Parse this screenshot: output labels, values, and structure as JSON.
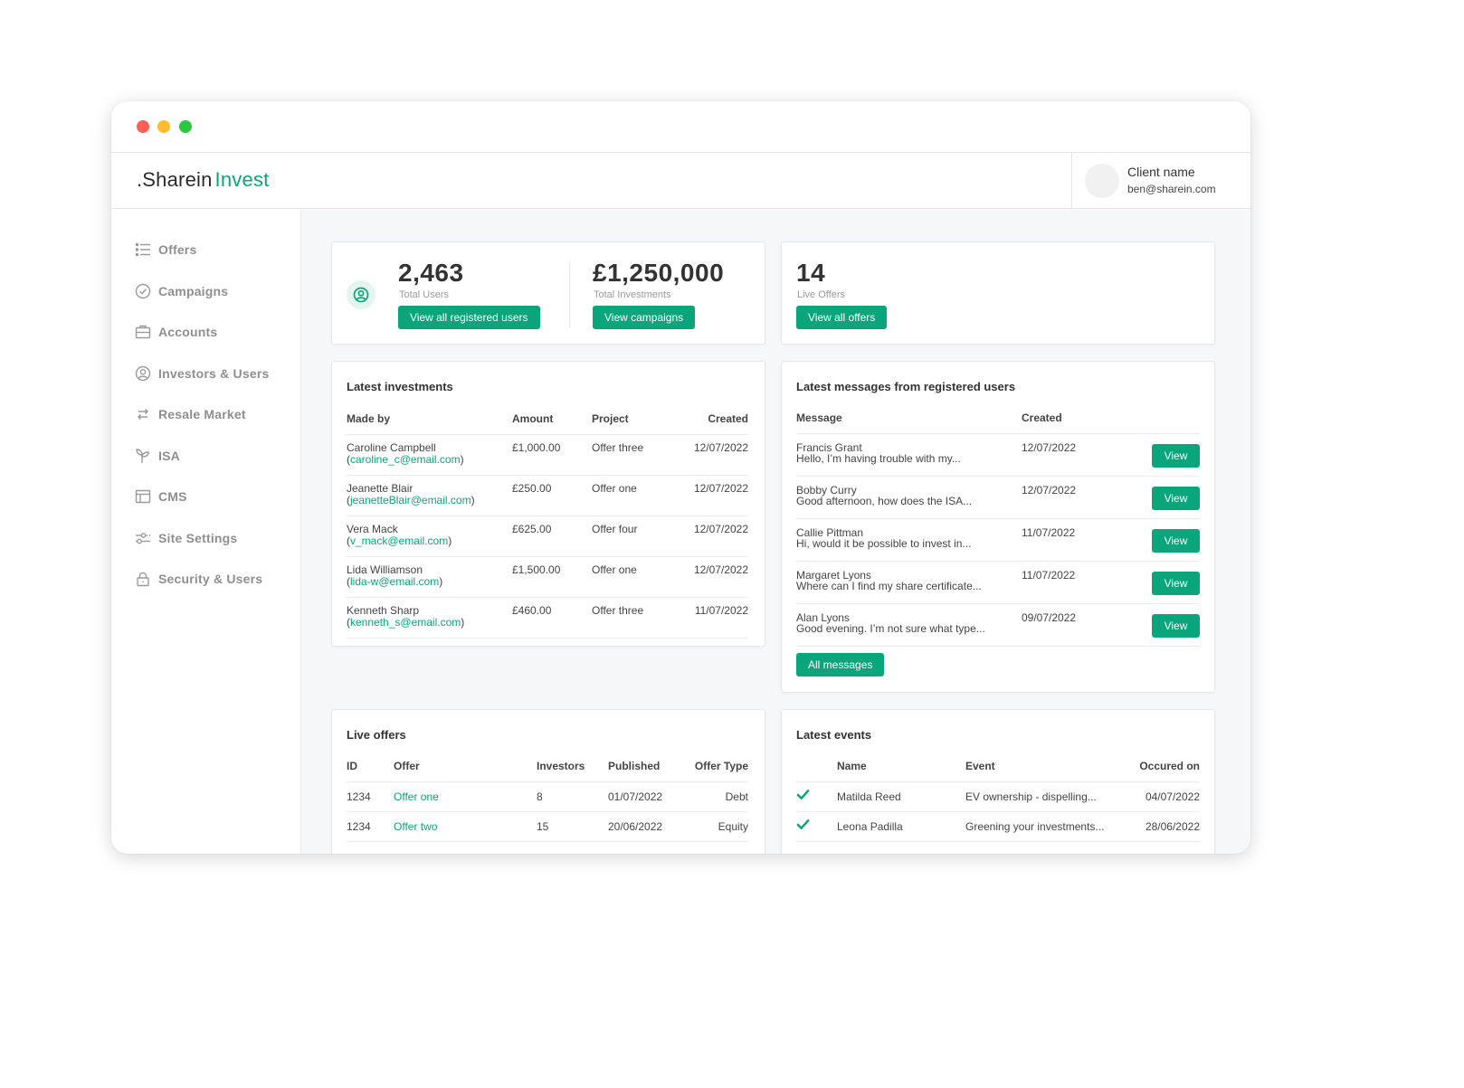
{
  "window": {
    "controls": [
      "close",
      "minimize",
      "maximize"
    ]
  },
  "header": {
    "logo_part1": ".Sharein",
    "logo_part2": "Invest",
    "client_name": "Client name",
    "client_email": "ben@sharein.com"
  },
  "sidebar": {
    "items": [
      {
        "label": "Offers",
        "icon": "list-icon"
      },
      {
        "label": "Campaigns",
        "icon": "check-circle-icon"
      },
      {
        "label": "Accounts",
        "icon": "briefcase-icon"
      },
      {
        "label": "Investors & Users",
        "icon": "user-circle-icon"
      },
      {
        "label": "Resale Market",
        "icon": "arrows-swap-icon"
      },
      {
        "label": "ISA",
        "icon": "sprout-icon"
      },
      {
        "label": "CMS",
        "icon": "layout-icon"
      },
      {
        "label": "Site Settings",
        "icon": "sliders-icon"
      },
      {
        "label": "Security & Users",
        "icon": "lock-icon"
      }
    ]
  },
  "stats": {
    "users": {
      "value": "2,463",
      "label": "Total Users",
      "button": "View all registered users"
    },
    "investments": {
      "value": "£1,250,000",
      "label": "Total Investments",
      "button": "View campaigns"
    },
    "offers": {
      "value": "14",
      "label": "Live Offers",
      "button": "View all offers"
    }
  },
  "latest_investments": {
    "title": "Latest investments",
    "columns": [
      "Made by",
      "Amount",
      "Project",
      "Created"
    ],
    "rows": [
      {
        "name": "Caroline Campbell",
        "email": "caroline_c@email.com",
        "amount": "£1,000.00",
        "project": "Offer three",
        "created": "12/07/2022"
      },
      {
        "name": "Jeanette Blair",
        "email": "jeanetteBlair@email.com",
        "amount": "£250.00",
        "project": "Offer one",
        "created": "12/07/2022"
      },
      {
        "name": "Vera Mack",
        "email": "v_mack@email.com",
        "amount": "£625.00",
        "project": "Offer four",
        "created": "12/07/2022"
      },
      {
        "name": "Lida Williamson",
        "email": "lida-w@email.com",
        "amount": "£1,500.00",
        "project": "Offer one",
        "created": "12/07/2022"
      },
      {
        "name": "Kenneth Sharp",
        "email": "kenneth_s@email.com",
        "amount": "£460.00",
        "project": "Offer three",
        "created": "11/07/2022"
      }
    ]
  },
  "latest_messages": {
    "title": "Latest messages from registered users",
    "columns": [
      "Message",
      "Created",
      ""
    ],
    "view_label": "View",
    "all_button": "All messages",
    "rows": [
      {
        "name": "Francis Grant",
        "preview": "Hello, I’m having trouble with my...",
        "created": "12/07/2022"
      },
      {
        "name": "Bobby Curry",
        "preview": "Good afternoon, how does the ISA...",
        "created": "12/07/2022"
      },
      {
        "name": "Callie Pittman",
        "preview": "Hi, would it be possible to invest in...",
        "created": "11/07/2022"
      },
      {
        "name": "Margaret Lyons",
        "preview": "Where can I find my share certificate...",
        "created": "11/07/2022"
      },
      {
        "name": "Alan Lyons",
        "preview": "Good evening. I’m not sure what type...",
        "created": "09/07/2022"
      }
    ]
  },
  "live_offers": {
    "title": "Live offers",
    "columns": [
      "ID",
      "Offer",
      "Investors",
      "Published",
      "Offer Type"
    ],
    "rows": [
      {
        "id": "1234",
        "offer": "Offer one",
        "investors": "8",
        "published": "01/07/2022",
        "type": "Debt"
      },
      {
        "id": "1234",
        "offer": "Offer two",
        "investors": "15",
        "published": "20/06/2022",
        "type": "Equity"
      }
    ]
  },
  "latest_events": {
    "title": "Latest events",
    "columns": [
      "",
      "Name",
      "Event",
      "Occured on"
    ],
    "rows": [
      {
        "status": "check-icon",
        "name": "Matilda Reed",
        "event": "EV ownership - dispelling...",
        "date": "04/07/2022"
      },
      {
        "status": "check-icon",
        "name": "Leona Padilla",
        "event": "Greening your investments...",
        "date": "28/06/2022"
      }
    ]
  }
}
